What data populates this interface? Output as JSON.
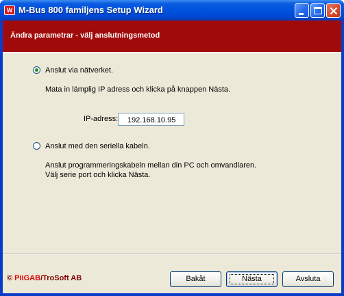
{
  "window": {
    "title": "M-Bus 800 familjens Setup Wizard",
    "icon_letter": "W",
    "icon_name": "app-icon",
    "controls": [
      "minimize-icon",
      "maximize-icon",
      "close-icon"
    ],
    "colors": {
      "titlebar": "#0052de",
      "header": "#a10a0a",
      "client": "#ece9d8"
    }
  },
  "header": {
    "title": "Ändra parametrar - välj anslutningsmetod"
  },
  "options": {
    "network": {
      "label": "Anslut via nätverket.",
      "description": "Mata in lämplig IP adress och klicka på knappen Nästa.",
      "selected": true,
      "ip_label": "IP-adress:",
      "ip_value": "192.168.10.95"
    },
    "serial": {
      "label": "Anslut med den seriella kabeln.",
      "description_line1": "Anslut programmeringskabeln mellan din PC och omvandlaren.",
      "description_line2": "Välj serie port och klicka Nästa.",
      "selected": false
    }
  },
  "footer": {
    "copyright": "©",
    "brand_highlight": "PiiGAB",
    "brand_rest": "/TroSoft AB",
    "buttons": {
      "back": "Bakåt",
      "next": "Nästa",
      "exit": "Avsluta"
    }
  }
}
